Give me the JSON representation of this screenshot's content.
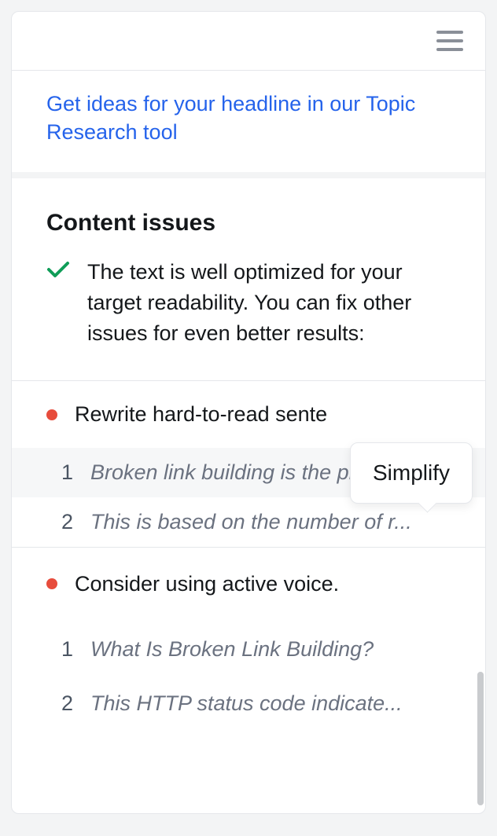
{
  "link": {
    "text": "Get ideas for your headline in our Topic Research tool"
  },
  "section": {
    "heading": "Content issues",
    "intro": "The text is well optimized for your target readability. You can fix other issues for even better results:"
  },
  "tooltip": {
    "label": "Simplify"
  },
  "groups": [
    {
      "title": "Rewrite hard-to-read sente",
      "items": [
        {
          "num": "1",
          "text": "Broken link building is the pr..."
        },
        {
          "num": "2",
          "text": "This is based on the number of r..."
        }
      ]
    },
    {
      "title": "Consider using active voice.",
      "items": [
        {
          "num": "1",
          "text": "What Is Broken Link Building?"
        },
        {
          "num": "2",
          "text": "This HTTP status code indicate..."
        }
      ]
    }
  ]
}
